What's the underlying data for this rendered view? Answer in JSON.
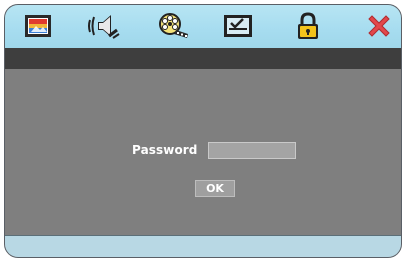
{
  "toolbar": {
    "items": [
      {
        "icon": "picture-icon"
      },
      {
        "icon": "speaker-icon"
      },
      {
        "icon": "film-reel-icon"
      },
      {
        "icon": "checklist-icon"
      },
      {
        "icon": "lock-icon"
      },
      {
        "icon": "close-icon"
      }
    ]
  },
  "dialog": {
    "password_label": "Password",
    "password_value": "",
    "ok_label": "OK"
  },
  "colors": {
    "toolbar": "#a6dcef",
    "band": "#3e3e3e",
    "panel": "#7f7f7f",
    "footer": "#b8d8e4",
    "close": "#e2474b",
    "lock": "#f3c31b"
  }
}
